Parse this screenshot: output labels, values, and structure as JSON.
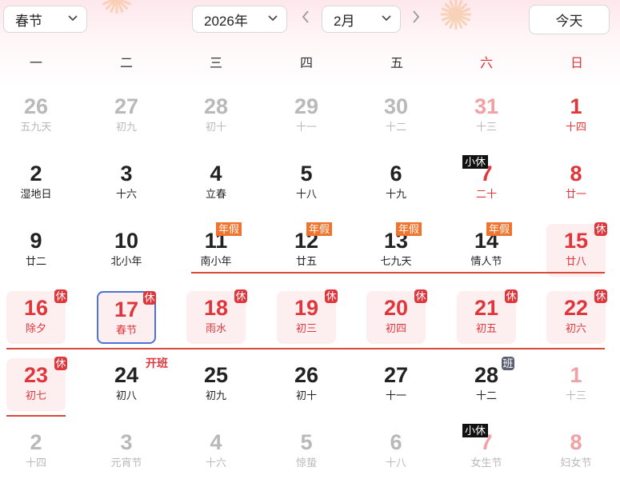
{
  "toolbar": {
    "holiday_select": "春节",
    "year_select": "2026年",
    "month_select": "2月",
    "prev_arrow": "‹",
    "next_arrow": "›",
    "today_label": "今天",
    "chevron": "⌄"
  },
  "weekdays": [
    "一",
    "二",
    "三",
    "四",
    "五",
    "六",
    "日"
  ],
  "colors": {
    "holiday_red": "#e0363b",
    "leave_orange": "#f0742d",
    "work_gray": "#596173",
    "today_blue": "#4d73d9",
    "holiday_bg": "#fdeef0"
  },
  "weeks": [
    [
      {
        "day": "26",
        "sub": "五九天",
        "style": "muted"
      },
      {
        "day": "27",
        "sub": "初九",
        "style": "muted"
      },
      {
        "day": "28",
        "sub": "初十",
        "style": "muted"
      },
      {
        "day": "29",
        "sub": "十一",
        "style": "muted"
      },
      {
        "day": "30",
        "sub": "十二",
        "style": "muted"
      },
      {
        "day": "31",
        "sub": "十三",
        "style": "muted-red"
      },
      {
        "day": "1",
        "sub": "十四",
        "style": "red-num"
      }
    ],
    [
      {
        "day": "2",
        "sub": "湿地日",
        "style": "normal"
      },
      {
        "day": "3",
        "sub": "十六",
        "style": "normal"
      },
      {
        "day": "4",
        "sub": "立春",
        "style": "normal"
      },
      {
        "day": "5",
        "sub": "十八",
        "style": "normal"
      },
      {
        "day": "6",
        "sub": "十九",
        "style": "normal"
      },
      {
        "day": "7",
        "sub": "二十",
        "style": "red-num",
        "tag": "小休",
        "tag_type": "mini"
      },
      {
        "day": "8",
        "sub": "廿一",
        "style": "red-num"
      }
    ],
    [
      {
        "day": "9",
        "sub": "廿二",
        "style": "normal"
      },
      {
        "day": "10",
        "sub": "北小年",
        "style": "normal"
      },
      {
        "day": "11",
        "sub": "南小年",
        "style": "normal",
        "tag": "年假",
        "tag_type": "leave"
      },
      {
        "day": "12",
        "sub": "廿五",
        "style": "normal",
        "tag": "年假",
        "tag_type": "leave"
      },
      {
        "day": "13",
        "sub": "七九天",
        "style": "normal",
        "tag": "年假",
        "tag_type": "leave"
      },
      {
        "day": "14",
        "sub": "情人节",
        "style": "normal",
        "tag": "年假",
        "tag_type": "leave"
      },
      {
        "day": "15",
        "sub": "廿八",
        "style": "holiday",
        "tag": "休",
        "tag_type": "rest"
      }
    ],
    [
      {
        "day": "16",
        "sub": "除夕",
        "style": "holiday",
        "tag": "休",
        "tag_type": "rest"
      },
      {
        "day": "17",
        "sub": "春节",
        "style": "holiday today",
        "tag": "休",
        "tag_type": "rest"
      },
      {
        "day": "18",
        "sub": "雨水",
        "style": "holiday",
        "tag": "休",
        "tag_type": "rest"
      },
      {
        "day": "19",
        "sub": "初三",
        "style": "holiday",
        "tag": "休",
        "tag_type": "rest"
      },
      {
        "day": "20",
        "sub": "初四",
        "style": "holiday",
        "tag": "休",
        "tag_type": "rest"
      },
      {
        "day": "21",
        "sub": "初五",
        "style": "holiday",
        "tag": "休",
        "tag_type": "rest"
      },
      {
        "day": "22",
        "sub": "初六",
        "style": "holiday",
        "tag": "休",
        "tag_type": "rest"
      }
    ],
    [
      {
        "day": "23",
        "sub": "初七",
        "style": "holiday",
        "tag": "休",
        "tag_type": "rest"
      },
      {
        "day": "24",
        "sub": "初八",
        "style": "normal",
        "tag": "开班",
        "tag_type": "workday"
      },
      {
        "day": "25",
        "sub": "初九",
        "style": "normal"
      },
      {
        "day": "26",
        "sub": "初十",
        "style": "normal"
      },
      {
        "day": "27",
        "sub": "十一",
        "style": "normal"
      },
      {
        "day": "28",
        "sub": "十二",
        "style": "normal",
        "tag": "班",
        "tag_type": "work"
      },
      {
        "day": "1",
        "sub": "十三",
        "style": "muted-red"
      }
    ],
    [
      {
        "day": "2",
        "sub": "十四",
        "style": "muted"
      },
      {
        "day": "3",
        "sub": "元宵节",
        "style": "muted"
      },
      {
        "day": "4",
        "sub": "十六",
        "style": "muted"
      },
      {
        "day": "5",
        "sub": "惊蛰",
        "style": "muted"
      },
      {
        "day": "6",
        "sub": "十八",
        "style": "muted"
      },
      {
        "day": "7",
        "sub": "女生节",
        "style": "muted-red",
        "tag": "小休",
        "tag_type": "mini"
      },
      {
        "day": "8",
        "sub": "妇女节",
        "style": "muted-red"
      }
    ]
  ]
}
